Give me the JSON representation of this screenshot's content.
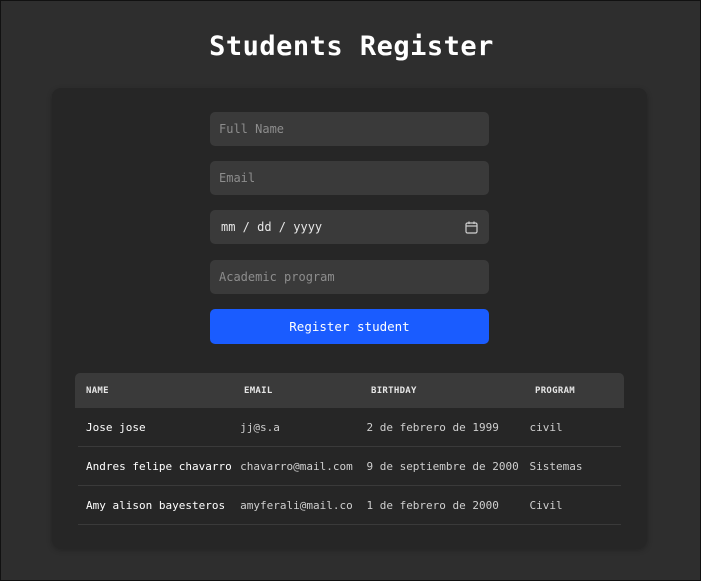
{
  "page": {
    "title": "Students Register"
  },
  "form": {
    "full_name_placeholder": "Full Name",
    "email_placeholder": "Email",
    "birthday_value": "mm / dd / yyyy",
    "program_placeholder": "Academic program",
    "submit_label": "Register student"
  },
  "table": {
    "headers": [
      "NAME",
      "EMAIL",
      "BIRTHDAY",
      "PROGRAM"
    ],
    "rows": [
      {
        "name": "Jose jose",
        "email": "jj@s.a",
        "birthday": "2 de febrero de 1999",
        "program": "civil"
      },
      {
        "name": "Andres felipe chavarro",
        "email": "chavarro@mail.com",
        "birthday": "9 de septiembre de 2000",
        "program": "Sistemas"
      },
      {
        "name": "Amy alison bayesteros",
        "email": "amyferali@mail.co",
        "birthday": "1 de febrero de 2000",
        "program": "Civil"
      }
    ]
  },
  "colors": {
    "background": "#2e2e2e",
    "card": "#262626",
    "input": "#3a3a3a",
    "accent": "#1a5cff"
  },
  "icons": {
    "date_picker": "calendar-icon"
  }
}
